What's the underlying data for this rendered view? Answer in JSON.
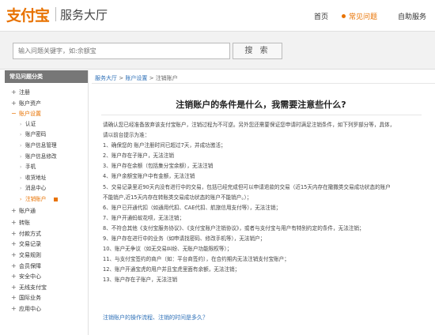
{
  "header": {
    "logo": "支付宝",
    "title": "服务大厅",
    "nav": {
      "home": "首页",
      "faq": "常见问题",
      "self_service": "自助服务"
    }
  },
  "search": {
    "placeholder": "输入问题关键字，如:余额宝",
    "button": "搜 索"
  },
  "sidebar": {
    "heading": "常见问题分类",
    "items_top": [
      {
        "label": "注册",
        "marker": "+"
      },
      {
        "label": "账户资产",
        "marker": "+"
      }
    ],
    "open_item": {
      "label": "账户设置",
      "marker": "−"
    },
    "sub_items": [
      "认证",
      "账户密码",
      "账户信息管理",
      "账户信息修改",
      "手机",
      "收货地址",
      "消息中心",
      "注销账户"
    ],
    "items_mid": [
      {
        "label": "账户通",
        "marker": "+"
      }
    ],
    "items_bottom": [
      {
        "label": "转账",
        "marker": "+"
      },
      {
        "label": "付款方式",
        "marker": "+"
      },
      {
        "label": "交易记录",
        "marker": "+"
      },
      {
        "label": "交易规则",
        "marker": "+"
      },
      {
        "label": "会员保障",
        "marker": "+"
      },
      {
        "label": "安全中心",
        "marker": "+"
      },
      {
        "label": "无线支付宝",
        "marker": "+"
      },
      {
        "label": "国际业务",
        "marker": "+"
      },
      {
        "label": "应用中心",
        "marker": "+"
      }
    ]
  },
  "breadcrumb": {
    "level1": "服务大厅",
    "level2": "账户设置",
    "current": "注销账户",
    "separator": ">"
  },
  "article": {
    "title": "注销账户的条件是什么，我需要注意些什么?",
    "intro": "请确认您已经准备放弃该支付宝账户，注销过程为不可逆。另外您还需要保证您申请时满足注销条件，如下列罗部分等，具体，请以前台提示为准：",
    "conditions": [
      "1、确保您的 账户注册时间已超过7天，并成功激活；",
      "2、账户存在子账户，无法注销",
      "3、账户存在余额（包括集分宝余额），无法注销",
      "4、账户余额宝账户中有金额，无法注销",
      "5、交易记录里近90天内没有进行中的交易，包括已经完成但可以申请退款的交易（近15天内存在撤撒类交易成功状态的账户不能销户,近15天内存在转账类交易成功状态的账户不能销户。）；",
      "6、账户已开通代扣（如通用代扣、CAE代扣、航旅信用支付等），无法注销；",
      "7、账户开通蚂蚁花呗，无法注销；",
      "8、不符合其他《支付宝服务协议》、《支付宝账户注销协议》，或者与支付宝与用户有特别约定的条件，无法注销；",
      "9、账户存在进行中的业务（如申请找密码、修改手机等），无法销户；",
      "10、账户无争议（如无交易纠纷、无账户功能限权等）；",
      "11、与支付宝签约的商户（如：平台商签约），在合约期内无法注销支付宝账户；",
      "12、账户开通宝虎的用户并且宝虎里面有余额，无法注销；",
      "13、账户存在子账户，无法注销"
    ]
  },
  "related_link": "注销账户的操作流程、注销的时间是多久？"
}
